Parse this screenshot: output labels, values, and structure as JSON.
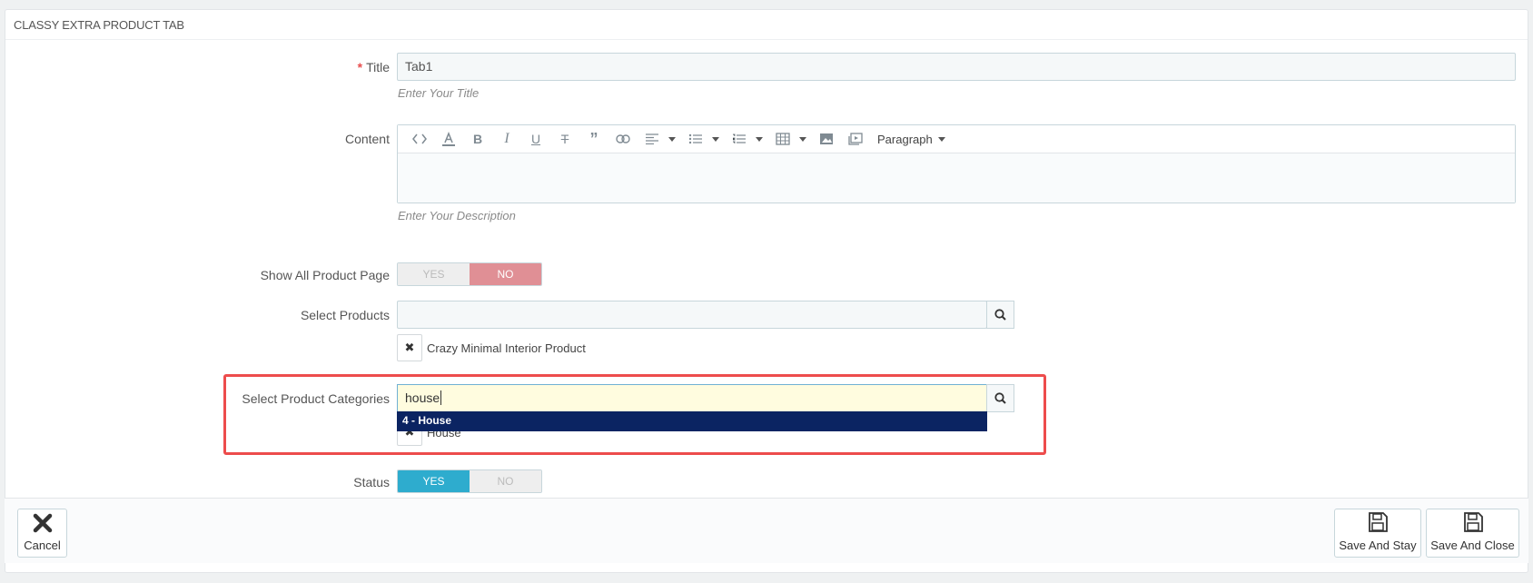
{
  "panel": {
    "title": "CLASSY EXTRA PRODUCT TAB"
  },
  "title_field": {
    "label": "Title",
    "required_mark": "*",
    "value": "Tab1",
    "help": "Enter Your Title"
  },
  "content_field": {
    "label": "Content",
    "help": "Enter Your Description",
    "toolbar": {
      "icons": [
        "code-icon",
        "font-color-icon",
        "bold-icon",
        "italic-icon",
        "underline-icon",
        "strikethrough-icon",
        "quote-icon",
        "link-icon",
        "align-icon",
        "bullet-list-icon",
        "numbered-list-icon",
        "table-icon",
        "image-icon",
        "video-icon"
      ],
      "paragraph_label": "Paragraph"
    }
  },
  "show_all": {
    "label": "Show All Product Page",
    "yes": "YES",
    "no": "NO",
    "selected": "NO"
  },
  "select_products": {
    "label": "Select Products",
    "value": "",
    "selected_items": [
      "Crazy Minimal Interior Product"
    ]
  },
  "select_categories": {
    "label": "Select Product Categories",
    "value": "house",
    "suggestion": "4 - House",
    "selected_items": [
      "House"
    ]
  },
  "status": {
    "label": "Status",
    "yes": "YES",
    "no": "NO",
    "selected": "YES"
  },
  "footer": {
    "cancel": "Cancel",
    "save_stay": "Save And Stay",
    "save_close": "Save And Close"
  },
  "colors": {
    "highlight_border": "#ed4c4c",
    "switch_no_active": "#e08f95",
    "switch_yes_active": "#2eacce",
    "autocomplete_bg": "#0b2462"
  }
}
